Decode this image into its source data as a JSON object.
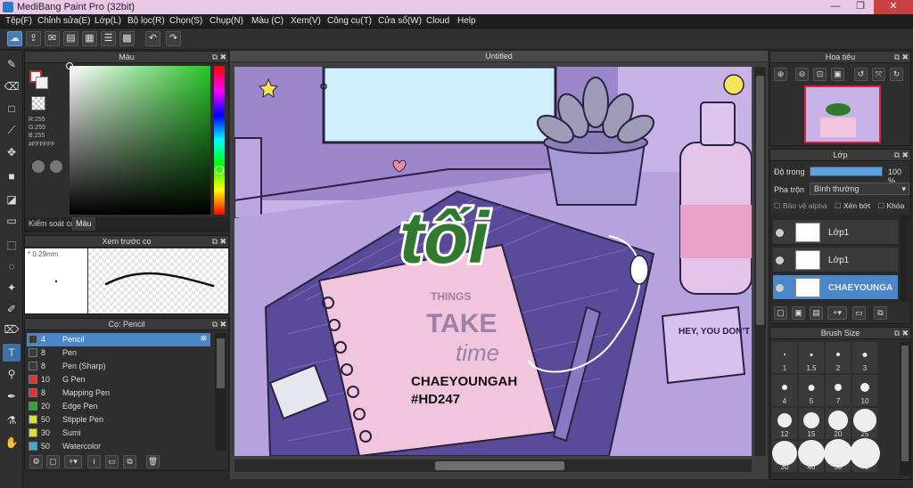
{
  "window": {
    "title": "MediBang Paint Pro (32bit)",
    "minimize": "—",
    "restore": "❐",
    "close": "✕"
  },
  "menu": [
    "Tệp(F)",
    "Chỉnh sửa(E)",
    "Lớp(L)",
    "Bộ lọc(R)",
    "Chọn(S)",
    "Chụp(N)",
    "Màu (C)",
    "Xem(V)",
    "Công cụ(T)",
    "Cửa sổ(W)",
    "Cloud",
    "Help"
  ],
  "color_panel": {
    "title": "Màu",
    "rgb": [
      "R:255",
      "G:255",
      "B:255"
    ],
    "hex": "#FFFFFF",
    "tabs": [
      "Kiểm soát cọ",
      "Màu"
    ],
    "primary": "#ffffff",
    "accent": "#cc2a2a"
  },
  "brush_preview": {
    "title": "Xem trước cọ",
    "size": "0.29mm"
  },
  "brush_panel": {
    "title": "Cọ: Pencil",
    "items": [
      {
        "size": "4",
        "name": "Pencil",
        "color": "#3a3a3a"
      },
      {
        "size": "8",
        "name": "Pen",
        "color": "#3a3a3a"
      },
      {
        "size": "8",
        "name": "Pen (Sharp)",
        "color": "#3a3a3a"
      },
      {
        "size": "10",
        "name": "G Pen",
        "color": "#d33"
      },
      {
        "size": "8",
        "name": "Mapping Pen",
        "color": "#d33"
      },
      {
        "size": "20",
        "name": "Edge Pen",
        "color": "#3a3"
      },
      {
        "size": "50",
        "name": "Stipple Pen",
        "color": "#dd3"
      },
      {
        "size": "30",
        "name": "Sumi",
        "color": "#dd3"
      },
      {
        "size": "50",
        "name": "Watercolor",
        "color": "#4ac"
      }
    ]
  },
  "canvas": {
    "tab": "Untitled",
    "lettering": "tối",
    "caption1": "CHAEYOUNGAH",
    "caption2": "#HD247",
    "note": "HEY, YOU DON'T GIVE UP, OKAY?",
    "notebook_words": [
      "THINGS",
      "TAKE",
      "time"
    ]
  },
  "navigator": {
    "title": "Hoa tiêu"
  },
  "layer_panel": {
    "title": "Lớp",
    "opacity_label": "Độ trong",
    "opacity_value": "100 %",
    "opacity": 1.0,
    "blend_label": "Pha trộn",
    "blend_value": "Bình thường",
    "checks": [
      "Bảo vệ alpha",
      "Xén bớt",
      "Khóa"
    ],
    "layers": [
      {
        "name": "Lớp1",
        "selected": false
      },
      {
        "name": "Lớp1",
        "selected": false
      },
      {
        "name": "CHAEYOUNGA",
        "selected": true
      }
    ]
  },
  "brush_size": {
    "title": "Brush Size",
    "sizes": [
      "1",
      "1.5",
      "2",
      "3",
      "4",
      "5",
      "7",
      "10",
      "12",
      "15",
      "20",
      "25",
      "30",
      "40",
      "50",
      "70"
    ]
  }
}
